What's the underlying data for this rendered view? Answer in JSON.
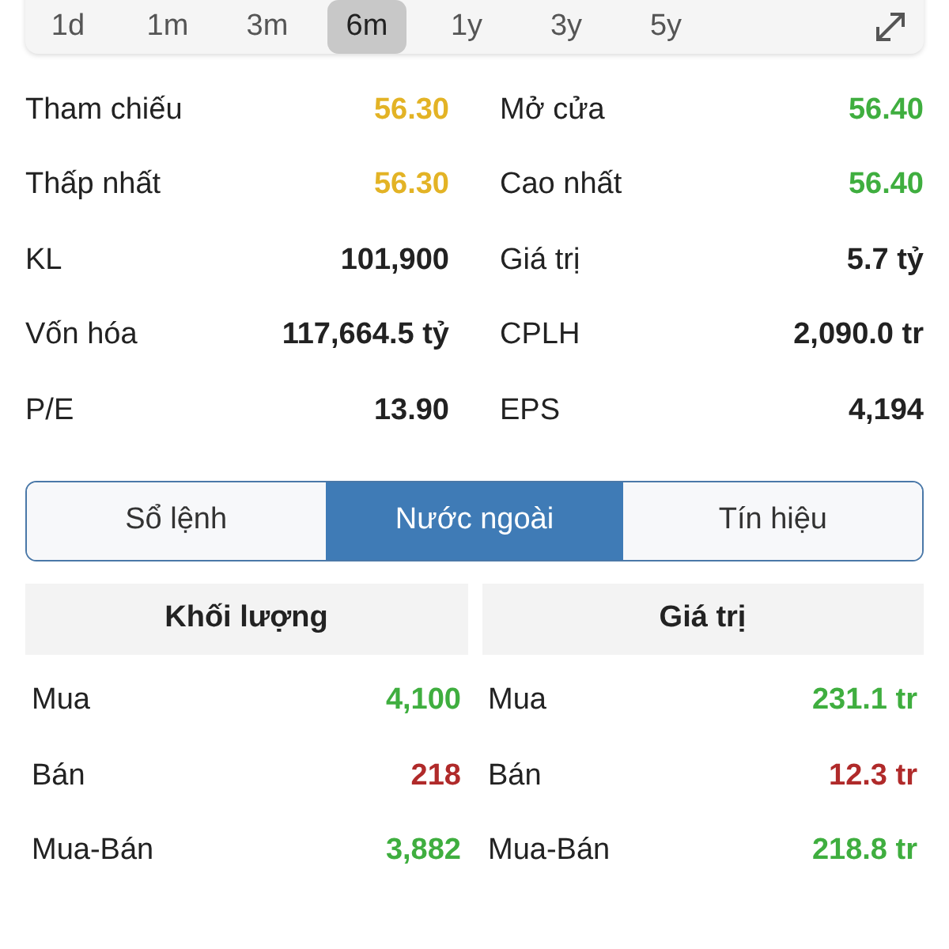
{
  "ranges": [
    {
      "label": "1d",
      "selected": false
    },
    {
      "label": "1m",
      "selected": false
    },
    {
      "label": "3m",
      "selected": false
    },
    {
      "label": "6m",
      "selected": true
    },
    {
      "label": "1y",
      "selected": false
    },
    {
      "label": "3y",
      "selected": false
    },
    {
      "label": "5y",
      "selected": false
    }
  ],
  "stats": [
    [
      {
        "label": "Tham chiếu",
        "value": "56.30",
        "color": "#e3b325"
      },
      {
        "label": "Mở cửa",
        "value": "56.40",
        "color": "#3fae3f"
      }
    ],
    [
      {
        "label": "Thấp nhất",
        "value": "56.30",
        "color": "#e3b325"
      },
      {
        "label": "Cao nhất",
        "value": "56.40",
        "color": "#3fae3f"
      }
    ],
    [
      {
        "label": "KL",
        "value": "101,900",
        "color": "#222222"
      },
      {
        "label": "Giá trị",
        "value": "5.7 tỷ",
        "color": "#222222"
      }
    ],
    [
      {
        "label": "Vốn hóa",
        "value": "117,664.5 tỷ",
        "color": "#222222"
      },
      {
        "label": "CPLH",
        "value": "2,090.0 tr",
        "color": "#222222"
      }
    ],
    [
      {
        "label": "P/E",
        "value": "13.90",
        "color": "#222222"
      },
      {
        "label": "EPS",
        "value": "4,194",
        "color": "#222222"
      }
    ]
  ],
  "tabs": [
    {
      "label": "Sổ lệnh",
      "selected": false
    },
    {
      "label": "Nước ngoài",
      "selected": true
    },
    {
      "label": "Tín hiệu",
      "selected": false
    }
  ],
  "foreign": [
    {
      "title": "Khối lượng",
      "rows": [
        {
          "label": "Mua",
          "value": "4,100",
          "color": "#3fae3f"
        },
        {
          "label": "Bán",
          "value": "218",
          "color": "#b02a2a"
        },
        {
          "label": "Mua-Bán",
          "value": "3,882",
          "color": "#3fae3f"
        }
      ]
    },
    {
      "title": "Giá trị",
      "rows": [
        {
          "label": "Mua",
          "value": "231.1 tr",
          "color": "#3fae3f"
        },
        {
          "label": "Bán",
          "value": "12.3 tr",
          "color": "#b02a2a"
        },
        {
          "label": "Mua-Bán",
          "value": "218.8 tr",
          "color": "#3fae3f"
        }
      ]
    }
  ]
}
